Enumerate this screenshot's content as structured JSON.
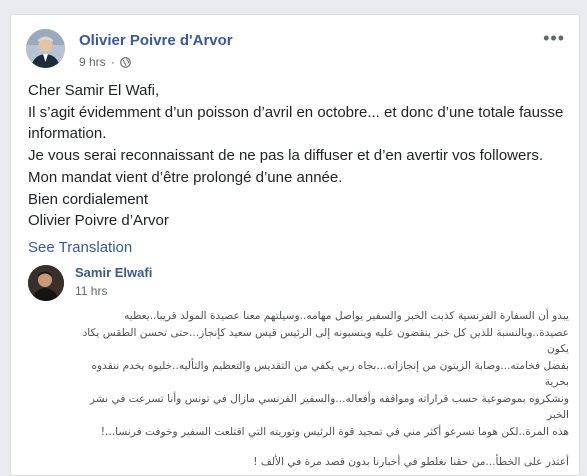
{
  "post": {
    "author": "Olivier Poivre d'Arvor",
    "time": "9 hrs",
    "separator": "·",
    "privacy_icon": "globe-icon",
    "more_icon": "more-options-icon",
    "more_label": "•••",
    "lines": [
      "Cher Samir El Wafi,",
      "Il s’agit évidemment d’un poisson d’avril en octobre... et donc d’une totale fausse information.",
      "Je vous serai reconnaissant de ne pas la diffuser et d’en avertir vos followers.",
      "Mon mandat vient d’être prolongé d’une année.",
      "Bien cordialement",
      "Olivier Poivre d’Arvor"
    ],
    "see_translation": "See Translation"
  },
  "comment": {
    "author": "Samir Elwafi",
    "time": "11 hrs",
    "lines": [
      "يبدو أن السفارة الفرنسية كذبت الخبر والسفير يواصل مهامه..وسيلتهم معنا عصيدة المولد قريبا..يعطيه",
      "عصيدة..وبالنسبة للذين كل خبر ينقضون عليه وينسبونه إلى الرئيس قيس سعيد كإنجاز...حتى تحسن الطقس يكاد يكون",
      "بفضل فخامته...وصابة الزيتون من إنجازاته...بجاه ربي يكفي من التقديس والتعظيم والتأليه..خليوه يخدم ننقدوه بحرية",
      "ونشكروه بموضوعية حسب قراراته ومواقفه وأفعاله...والسفير الفرنسي مازال في تونس وأنا تسرعت في نشر الخبر",
      "هذه المرة..لكن هوما تسرعو أكثر مني في تمجيد قوة الرئيس وتوريته التي اقتلعت السفير وخوفت فرنسا...!"
    ],
    "apology": "أعتذر على الخطأ...من حقنا نغلطو في أخبارنا بدون قصد مرة في الألف !"
  }
}
